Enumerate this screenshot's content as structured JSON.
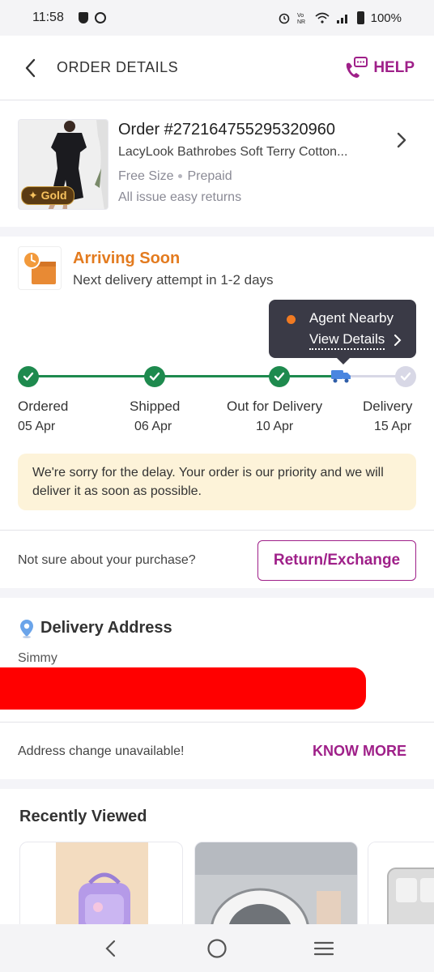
{
  "status_bar": {
    "time": "11:58",
    "battery": "100%"
  },
  "header": {
    "title": "ORDER DETAILS",
    "help_label": "HELP"
  },
  "order": {
    "id": "Order #272164755295320960",
    "product_name": "LacyLook Bathrobes Soft Terry Cotton...",
    "size": "Free Size",
    "payment": "Prepaid",
    "returns_note": "All issue easy returns",
    "badge": "✦ Gold"
  },
  "status": {
    "title": "Arriving Soon",
    "subtitle": "Next delivery attempt in 1-2 days",
    "tooltip_title": "Agent Nearby",
    "tooltip_link": "View Details",
    "steps": [
      {
        "label": "Ordered",
        "date": "05 Apr"
      },
      {
        "label": "Shipped",
        "date": "06 Apr"
      },
      {
        "label": "Out for Delivery",
        "date": "10 Apr"
      },
      {
        "label": "Delivery",
        "date": "15 Apr"
      }
    ],
    "delay_message": "We're sorry for the delay. Your order is our priority and we will deliver it as soon as possible."
  },
  "return": {
    "question": "Not sure about your purchase?",
    "button_label": "Return/Exchange"
  },
  "address": {
    "title": "Delivery Address",
    "name": "Simmy",
    "change_label": "Address change unavailable!",
    "know_more_label": "KNOW MORE"
  },
  "recent": {
    "title": "Recently Viewed"
  },
  "colors": {
    "brand": "#9f2089",
    "success": "#1e8a4e",
    "warning": "#e37b1f",
    "delay_bg": "#fdf3d9",
    "redaction": "#ff0000"
  },
  "icons": {
    "back": "chevron-left-icon",
    "help": "phone-chat-icon",
    "chevron": "chevron-right-icon",
    "status": "package-clock-icon",
    "truck": "truck-icon",
    "check": "check-icon",
    "pin": "location-pin-icon"
  }
}
